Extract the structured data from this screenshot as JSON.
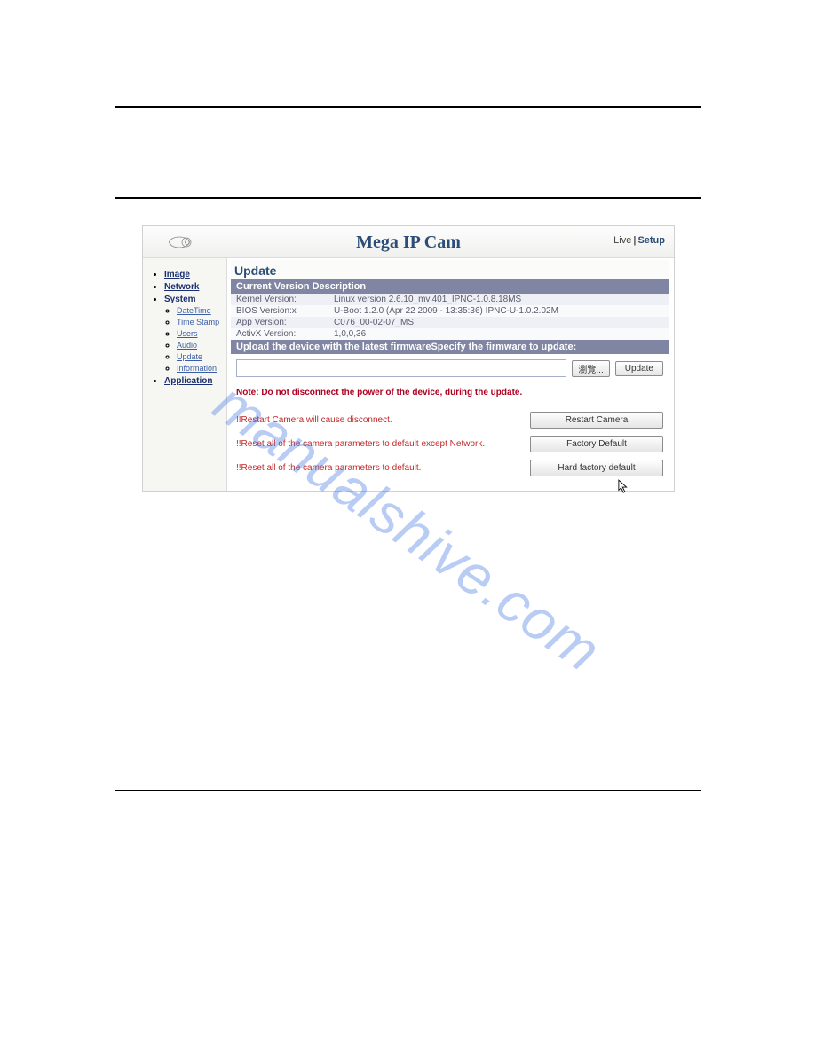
{
  "watermark": "manualshive.com",
  "header": {
    "title": "Mega IP Cam",
    "live": "Live",
    "setup": "Setup"
  },
  "sidebar": {
    "main": [
      {
        "label": "Image"
      },
      {
        "label": "Network"
      },
      {
        "label": "System",
        "sub": [
          {
            "label": "DateTime"
          },
          {
            "label": "Time Stamp"
          },
          {
            "label": "Users"
          },
          {
            "label": "Audio"
          },
          {
            "label": "Update"
          },
          {
            "label": "Information"
          }
        ]
      },
      {
        "label": "Application"
      }
    ]
  },
  "page": {
    "title": "Update",
    "section1": "Current Version Description",
    "kv": [
      {
        "k": "Kernel Version:",
        "v": "Linux version 2.6.10_mvl401_IPNC-1.0.8.18MS"
      },
      {
        "k": "BIOS Version:x",
        "v": "U-Boot 1.2.0 (Apr 22 2009 - 13:35:36) IPNC-U-1.0.2.02M"
      },
      {
        "k": "App Version:",
        "v": "C076_00-02-07_MS"
      },
      {
        "k": "ActivX Version:",
        "v": "1,0,0,36"
      }
    ],
    "section2": "Upload the device with the latest firmwareSpecify the firmware to update:",
    "browse": "瀏覽...",
    "update_btn": "Update",
    "note": "Note: Do not disconnect the power of the device, during the update.",
    "warn": [
      {
        "msg": "!!Restart Camera will cause disconnect.",
        "btn": "Restart Camera"
      },
      {
        "msg": "!!Reset all of the camera parameters to default except Network.",
        "btn": "Factory Default"
      },
      {
        "msg": "!!Reset all of the camera parameters to default.",
        "btn": "Hard factory default"
      }
    ]
  }
}
